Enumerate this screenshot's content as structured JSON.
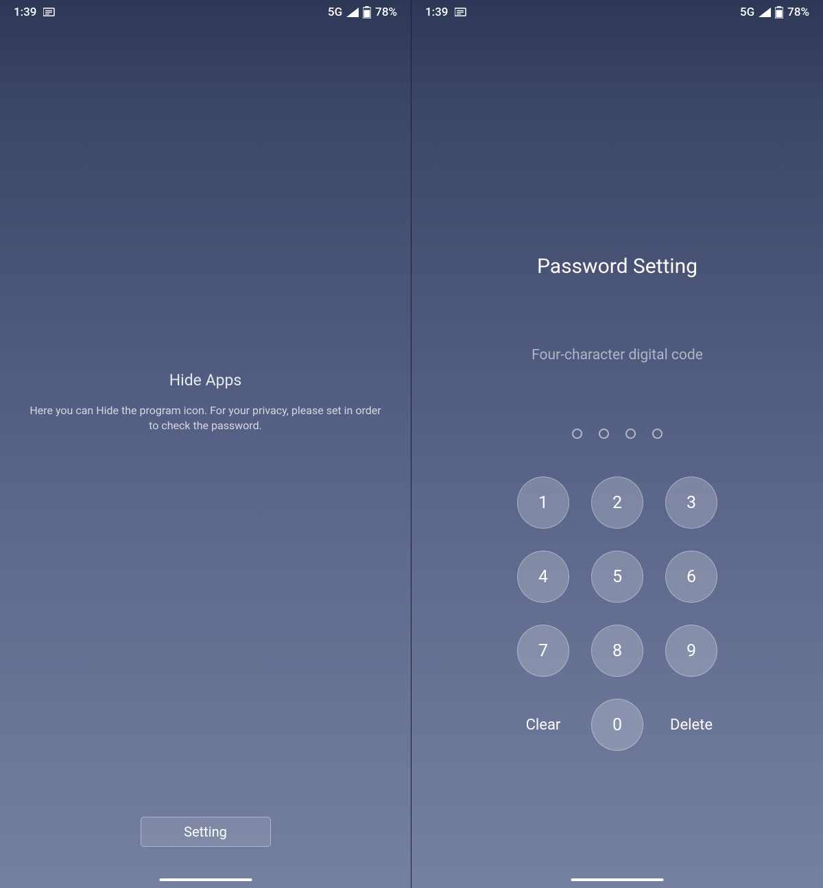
{
  "status_bar": {
    "time": "1:39",
    "network": "5G",
    "battery": "78%"
  },
  "left_screen": {
    "title": "Hide Apps",
    "description": "Here you can Hide the program icon. For your privacy, please set in order to check the password.",
    "button_label": "Setting"
  },
  "right_screen": {
    "title": "Password Setting",
    "subtitle": "Four-character digital code",
    "pin_length": 4,
    "keypad": {
      "keys": [
        "1",
        "2",
        "3",
        "4",
        "5",
        "6",
        "7",
        "8",
        "9",
        "0"
      ],
      "clear_label": "Clear",
      "delete_label": "Delete"
    }
  }
}
